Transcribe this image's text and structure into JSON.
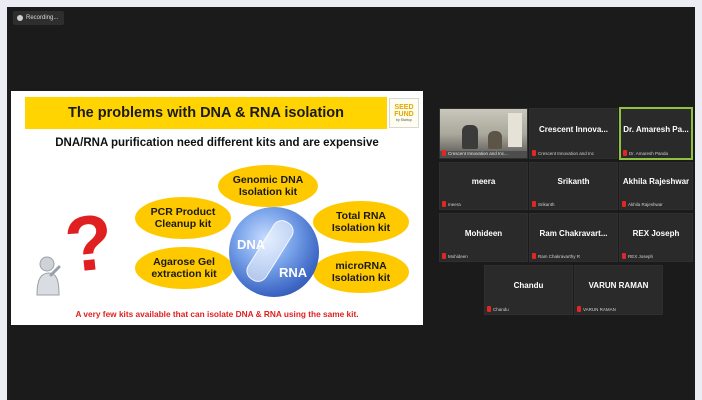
{
  "recording": {
    "label": "Recording...",
    "icon": "recording-icon"
  },
  "slide": {
    "title": "The problems with DNA & RNA isolation",
    "logo": {
      "line1": "SEED",
      "line2": "FUND",
      "line3": "by Startup"
    },
    "subtitle": "DNA/RNA purification need different kits and are expensive",
    "kits": {
      "genomic": "Genomic DNA\nIsolation kit",
      "pcr": "PCR Product\nCleanup kit",
      "total_rna": "Total RNA\nIsolation kit",
      "agarose": "Agarose Gel\nextraction kit",
      "microrna": "microRNA\nIsolation kit"
    },
    "center": {
      "dna": "DNA",
      "rna": "RNA"
    },
    "footer": "A very few kits available that can isolate DNA & RNA using the same kit.",
    "colors": {
      "title_bg": "#ffd400",
      "kit_bg": "#ffc900",
      "accent_red": "#e02020"
    }
  },
  "gallery": {
    "video_tile": {
      "name": "Crescent Innovation and Inc..."
    },
    "participants": [
      {
        "display": "Crescent Innova...",
        "label": "Crescent Innovation and Inc"
      },
      {
        "display": "Dr. Amaresh Pa...",
        "label": "Dr. Amaresh Panda",
        "active": true
      },
      {
        "display": "meera",
        "label": "meera"
      },
      {
        "display": "Srikanth",
        "label": "Srikanth"
      },
      {
        "display": "Akhila Rajeshwar",
        "label": "Akhila Rajeshwar"
      },
      {
        "display": "Mohideen",
        "label": "Mohideen"
      },
      {
        "display": "Ram Chakravart...",
        "label": "Ram Chakravarthy R"
      },
      {
        "display": "REX Joseph",
        "label": "REX Joseph"
      },
      {
        "display": "Chandu",
        "label": "Chandu"
      },
      {
        "display": "VARUN RAMAN",
        "label": "VARUN RAMAN"
      }
    ],
    "colors": {
      "active_border": "#8fc142",
      "muted_mic": "#e02626"
    }
  }
}
